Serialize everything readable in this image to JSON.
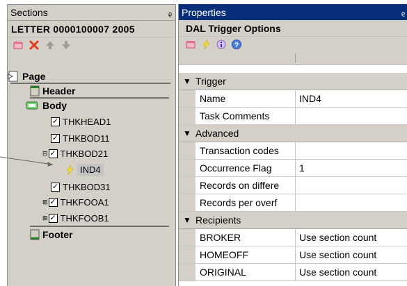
{
  "sections_pane": {
    "title": "Sections",
    "pin_glyph": "ᵨ",
    "document_label": "LETTER  0000100007  2005",
    "toolbar": {
      "icons": [
        "add-section-icon",
        "delete-icon",
        "move-up-icon",
        "move-down-icon"
      ]
    },
    "tree": {
      "page": "Page",
      "header": "Header",
      "body": "Body",
      "items": [
        "THKHEAD1",
        "THKBOD11",
        "THKBOD21",
        "IND4",
        "THKBOD31",
        "THKFOOA1",
        "THKFOOB1"
      ],
      "footer": "Footer"
    }
  },
  "properties_pane": {
    "title": "Properties",
    "pin_glyph": "ᵨ",
    "header": "DAL Trigger Options",
    "toolbar": {
      "icons": [
        "categorized-icon",
        "lightning-icon",
        "info-icon",
        "help-icon"
      ]
    },
    "categories": [
      {
        "name": "Trigger",
        "rows": [
          {
            "name": "Name",
            "value": "IND4"
          },
          {
            "name": "Task Comments",
            "value": ""
          }
        ]
      },
      {
        "name": "Advanced",
        "rows": [
          {
            "name": "Transaction codes",
            "value": ""
          },
          {
            "name": "Occurrence Flag",
            "value": "1"
          },
          {
            "name": "Records on differe",
            "value": ""
          },
          {
            "name": "Records per overf",
            "value": ""
          }
        ]
      },
      {
        "name": "Recipients",
        "rows": [
          {
            "name": "BROKER",
            "value": "Use section count"
          },
          {
            "name": "HOMEOFF",
            "value": "Use section count"
          },
          {
            "name": "ORIGINAL",
            "value": "Use section count"
          }
        ]
      }
    ]
  },
  "colors": {
    "panel_bg": "#d4d0c8",
    "active_title_bg": "#0a2f7a",
    "header_green": "#1e8a1e"
  }
}
